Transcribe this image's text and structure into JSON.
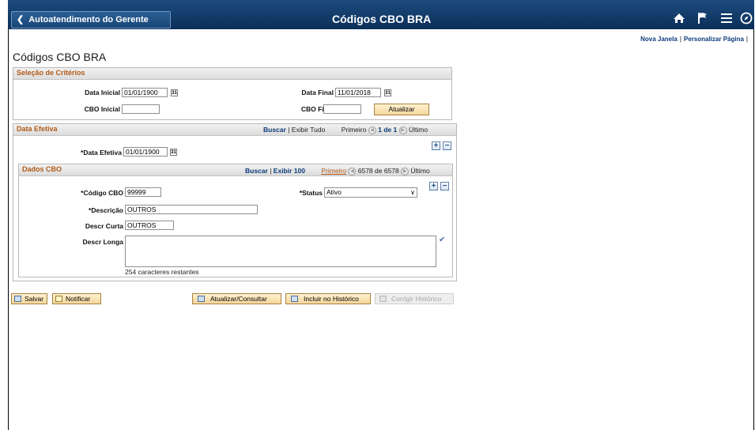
{
  "header": {
    "back_label": "Autoatendimento do Gerente",
    "title": "Códigos CBO BRA",
    "icons": [
      "home-icon",
      "flag-icon",
      "menu-icon",
      "compass-icon"
    ]
  },
  "links": {
    "new_window": "Nova Janela",
    "personalize": "Personalizar Página",
    "separator": "|"
  },
  "page_title": "Códigos CBO BRA",
  "criteria": {
    "title": "Seleção de Critérios",
    "start_date_label": "Data Inicial",
    "start_date": "01/01/1900",
    "end_date_label": "Data Final",
    "end_date": "11/01/2018",
    "cbo_start_label": "CBO Inicial",
    "cbo_start": "",
    "cbo_end_label": "CBO Final",
    "cbo_end": "",
    "update_button": "Atualizar"
  },
  "effdt": {
    "title": "Data Efetiva",
    "find": "Buscar",
    "sep": "|",
    "view_all": "Exibir Tudo",
    "first": "Primeiro",
    "count": "1 de 1",
    "last": "Último",
    "field_label": "*Data Efetiva",
    "field_value": "01/01/1900"
  },
  "cbo": {
    "title": "Dados CBO",
    "find": "Buscar",
    "sep": "|",
    "view_100": "Exibir 100",
    "first": "Primeiro",
    "count": "6578 de 6578",
    "last": "Último",
    "code_label": "*Código CBO",
    "code_value": "99999",
    "status_label": "*Status",
    "status_value": "Ativo",
    "descr_label": "*Descrição",
    "descr_value": "OUTROS",
    "short_label": "Descr Curta",
    "short_value": "OUTROS",
    "long_label": "Descr Longa",
    "long_value": "",
    "remaining": "254 caracteres restantes"
  },
  "toolbar": {
    "save": "Salvar",
    "notify": "Notificar",
    "update_display": "Atualizar/Consultar",
    "include_history": "Incluir no Histórico",
    "correct_history": "Corrigir Histórico"
  }
}
